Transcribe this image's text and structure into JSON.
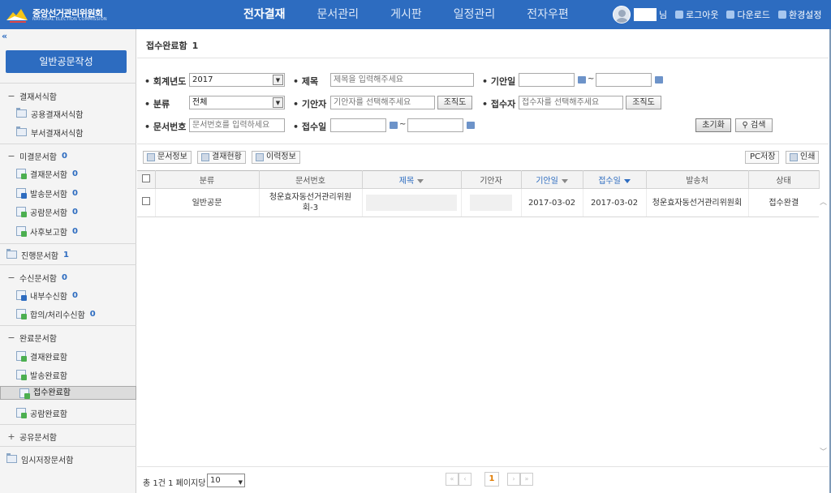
{
  "app": {
    "org_name": "중앙선거관리위원회",
    "org_sub": "NATIONAL ELECTION COMMISSION"
  },
  "topnav": [
    "전자결재",
    "문서관리",
    "게시판",
    "일정관리",
    "전자우편"
  ],
  "topnav_active": 0,
  "user": {
    "suffix": "님",
    "links": [
      "로그아웃",
      "다운로드",
      "환경설정"
    ]
  },
  "colors": {
    "brand": "#2d6cc0",
    "accent": "#e07b00",
    "status_done": "#4caf50"
  },
  "sidebar": {
    "collapse": "«",
    "write_button": "일반공문작성",
    "items": [
      {
        "label": "결재서식함",
        "type": "group",
        "toggle": "−",
        "count": ""
      },
      {
        "label": "공용결재서식함",
        "type": "folder",
        "count": ""
      },
      {
        "label": "부서결재서식함",
        "type": "folder",
        "count": ""
      },
      {
        "label": "미결문서함",
        "type": "group",
        "toggle": "−",
        "count": "0"
      },
      {
        "label": "결재문서함",
        "type": "doc",
        "count": "0"
      },
      {
        "label": "발송문서함",
        "type": "doc",
        "count": "0"
      },
      {
        "label": "공람문서함",
        "type": "doc",
        "count": "0"
      },
      {
        "label": "사후보고함",
        "type": "doc",
        "count": "0"
      },
      {
        "label": "진행문서함",
        "type": "folder-top",
        "count": "1"
      },
      {
        "label": "수신문서함",
        "type": "group",
        "toggle": "−",
        "count": "0"
      },
      {
        "label": "내부수신함",
        "type": "doc",
        "count": "0"
      },
      {
        "label": "합의/처리수신함",
        "type": "doc",
        "count": "0"
      },
      {
        "label": "완료문서함",
        "type": "group",
        "toggle": "−",
        "count": ""
      },
      {
        "label": "결재완료함",
        "type": "doc",
        "count": ""
      },
      {
        "label": "발송완료함",
        "type": "doc",
        "count": ""
      },
      {
        "label": "접수완료함",
        "type": "doc",
        "count": "",
        "selected": true
      },
      {
        "label": "공람완료함",
        "type": "doc",
        "count": ""
      },
      {
        "label": "공유문서함",
        "type": "group",
        "toggle": "+",
        "count": ""
      },
      {
        "label": "임시저장문서함",
        "type": "folder-top",
        "count": ""
      }
    ]
  },
  "main": {
    "title": "접수완료함",
    "title_count": "1",
    "search": {
      "year_label": "• 회계년도",
      "year_value": "2017",
      "title_label": "• 제목",
      "title_placeholder": "제목을 입력해주세요",
      "draftdate_label": "• 기안일",
      "category_label": "• 분류",
      "category_value": "전체",
      "drafter_label": "• 기안자",
      "drafter_placeholder": "기안자를 선택해주세요",
      "receiver_label": "• 접수자",
      "receiver_placeholder": "접수자를 선택해주세요",
      "org_button": "조직도",
      "docno_label": "• 문서번호",
      "docno_placeholder": "문서번호를 입력하세요",
      "recvdate_label": "• 접수일",
      "tilde": "~",
      "reset_button": "초기화",
      "search_button": "검색"
    },
    "toolbar": {
      "doc_info": "문서정보",
      "approval_status": "결재현황",
      "history": "이력정보",
      "pc_save": "PC저장",
      "print": "인쇄"
    },
    "table": {
      "columns": [
        "분류",
        "문서번호",
        "제목",
        "기안자",
        "기안일",
        "접수일",
        "발송처",
        "상태"
      ],
      "rows": [
        {
          "category": "일반공문",
          "doc_no": "청운효자동선거관리위원회-3",
          "title": "",
          "drafter": "",
          "draft_date": "2017-03-02",
          "recv_date": "2017-03-02",
          "sender": "청운효자동선거관리위원회",
          "status": "접수완결"
        }
      ]
    },
    "footer": {
      "total": "총 1건 1 페이지당",
      "page_size": "10",
      "current_page": "1"
    }
  }
}
